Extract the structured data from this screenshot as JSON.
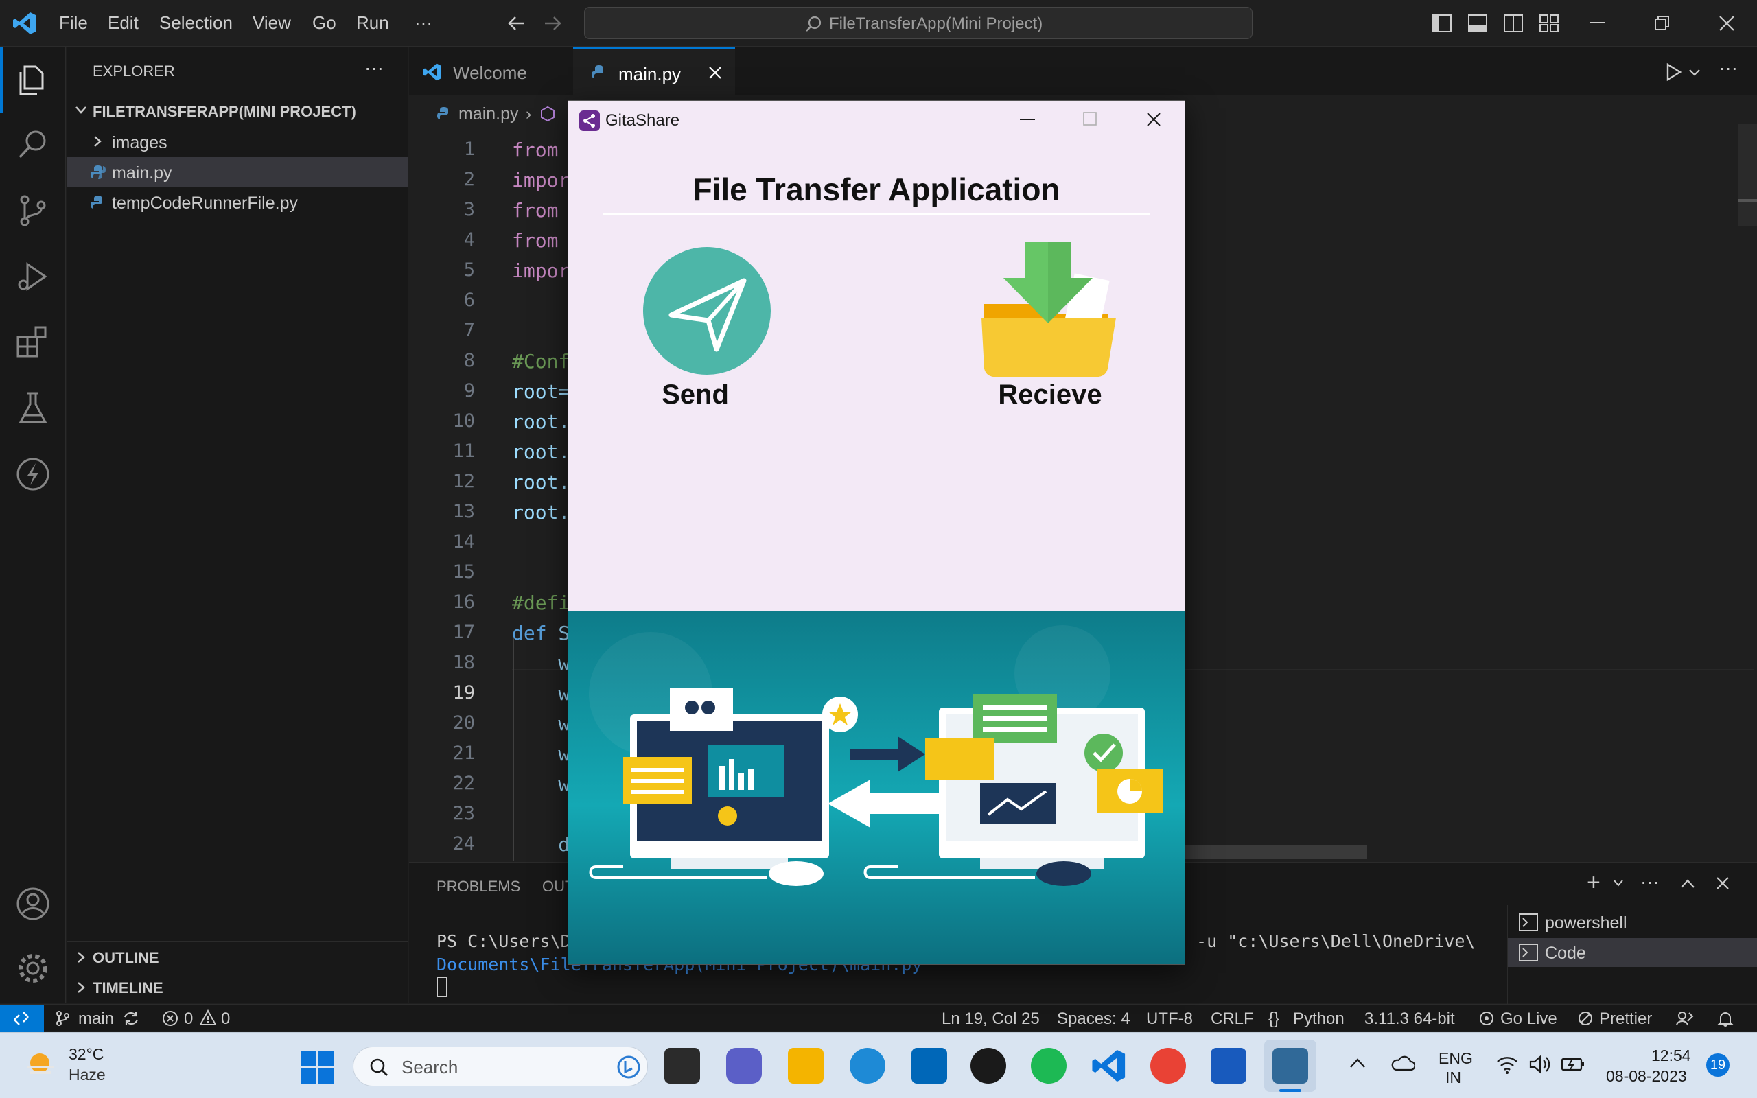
{
  "titlebar": {
    "menu": [
      "File",
      "Edit",
      "Selection",
      "View",
      "Go",
      "Run",
      "···"
    ],
    "search_text": "FileTransferApp(Mini Project)"
  },
  "sidebar": {
    "header": "EXPLORER",
    "project": "FILETRANSFERAPP(MINI PROJECT)",
    "items": [
      {
        "label": "images"
      },
      {
        "label": "main.py"
      },
      {
        "label": "tempCodeRunnerFile.py"
      }
    ],
    "outline": "OUTLINE",
    "timeline": "TIMELINE"
  },
  "tabs": [
    {
      "label": "Welcome"
    },
    {
      "label": "main.py"
    }
  ],
  "breadcrumb": {
    "file": "main.py"
  },
  "editor": {
    "line_numbers": [
      "1",
      "2",
      "3",
      "4",
      "5",
      "6",
      "7",
      "8",
      "9",
      "10",
      "11",
      "12",
      "13",
      "14",
      "15",
      "16",
      "17",
      "18",
      "19",
      "20",
      "21",
      "22",
      "23",
      "24"
    ],
    "lines": [
      {
        "kw": "from",
        "rest": ""
      },
      {
        "kw": "impor",
        "rest": ""
      },
      {
        "kw": "from",
        "rest": ""
      },
      {
        "kw": "from",
        "rest": ""
      },
      {
        "kw": "impor",
        "rest": ""
      },
      {
        "kw": "",
        "rest": ""
      },
      {
        "kw": "",
        "rest": ""
      },
      {
        "cm": "#Conf"
      },
      {
        "rest": "root="
      },
      {
        "rest": "root."
      },
      {
        "rest": "root."
      },
      {
        "rest": "root."
      },
      {
        "rest": "root."
      },
      {
        "rest": ""
      },
      {
        "rest": ""
      },
      {
        "cm": "#defi"
      },
      {
        "kw2": "def",
        "rest": " S"
      },
      {
        "rest": "    w"
      },
      {
        "rest": "    w"
      },
      {
        "rest": "    w"
      },
      {
        "rest": "    w"
      },
      {
        "rest": "    w"
      },
      {
        "rest": ""
      },
      {
        "rest": "    d"
      }
    ]
  },
  "panel": {
    "tabs": [
      "PROBLEMS",
      "OUT"
    ],
    "terminal_line1": "PS C:\\Users\\D",
    "terminal_line1_tail": " -u \"c:\\Users\\Dell\\OneDrive\\",
    "terminal_line2": "Documents\\FileTransferApp(Mini Project)\\main.py",
    "terminals": [
      "powershell",
      "Code"
    ]
  },
  "statusbar": {
    "branch": "main",
    "errors": "0",
    "warnings": "0",
    "position": "Ln 19, Col 25",
    "spaces": "Spaces: 4",
    "encoding": "UTF-8",
    "eol": "CRLF",
    "language": "Python",
    "interpreter": "3.11.3 64-bit",
    "golive": "Go Live",
    "prettier": "Prettier"
  },
  "app_window": {
    "title": "GitaShare",
    "heading": "File Transfer Application",
    "send_label": "Send",
    "receive_label": "Recieve",
    "colors": {
      "send_circle": "#4db6a8",
      "folder": "#f5c518",
      "arrow": "#5cb85c"
    }
  },
  "taskbar": {
    "weather_temp": "32°C",
    "weather_desc": "Haze",
    "search_placeholder": "Search",
    "lang_top": "ENG",
    "lang_bottom": "IN",
    "time": "12:54",
    "date": "08-08-2023",
    "notifications": "19"
  }
}
